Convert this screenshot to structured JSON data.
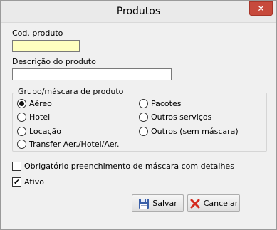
{
  "window": {
    "title": "Produtos",
    "close_glyph": "✕"
  },
  "form": {
    "cod_produto": {
      "label": "Cod. produto",
      "value": ""
    },
    "descricao": {
      "label": "Descrição do produto",
      "value": ""
    },
    "grupo": {
      "legend": "Grupo/máscara de produto",
      "options": [
        {
          "label": "Aéreo",
          "checked": true
        },
        {
          "label": "Hotel",
          "checked": false
        },
        {
          "label": "Locação",
          "checked": false
        },
        {
          "label": "Transfer Aer./Hotel/Aer.",
          "checked": false
        },
        {
          "label": "Pacotes",
          "checked": false
        },
        {
          "label": "Outros serviços",
          "checked": false
        },
        {
          "label": "Outros (sem máscara)",
          "checked": false
        }
      ]
    },
    "obrigatorio": {
      "label": "Obrigatório preenchimento de máscara com detalhes",
      "checked": false
    },
    "ativo": {
      "label": "Ativo",
      "checked": true,
      "check_glyph": "✔"
    }
  },
  "buttons": {
    "salvar": {
      "label": "Salvar",
      "icon": "floppy-disk-icon"
    },
    "cancelar": {
      "label": "Cancelar",
      "icon": "red-x-icon"
    }
  },
  "colors": {
    "focused_input": "#ffffc0",
    "close_button": "#c74a3c"
  }
}
